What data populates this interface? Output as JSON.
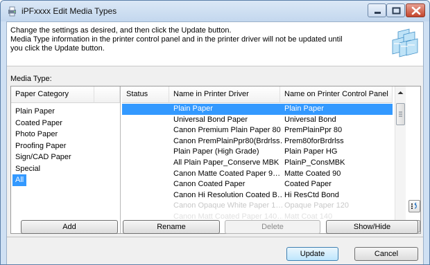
{
  "window": {
    "title": "iPFxxxx Edit Media Types"
  },
  "banner": {
    "lines": [
      "Change the settings as desired, and then click the Update button.",
      "Media Type information in the printer control panel and in the printer driver will not be updated until",
      "you click the Update button."
    ]
  },
  "media_label": "Media Type:",
  "category_header": "Paper Category",
  "categories": [
    "Plain Paper",
    "Coated Paper",
    "Photo Paper",
    "Proofing Paper",
    "Sign/CAD Paper",
    "Special",
    "All"
  ],
  "selected_category": "All",
  "table": {
    "headers": [
      "Status",
      "Name in Printer Driver",
      "Name on Printer Control Panel"
    ],
    "rows": [
      {
        "status": "",
        "driver": "Plain Paper",
        "panel": "Plain Paper"
      },
      {
        "status": "",
        "driver": "Universal Bond Paper",
        "panel": "Universal Bond"
      },
      {
        "status": "",
        "driver": "Canon Premium Plain Paper 80",
        "panel": "PremPlainPpr 80"
      },
      {
        "status": "",
        "driver": "Canon PremPlainPpr80(Brdrlss…",
        "panel": "Prem80forBrdrlss"
      },
      {
        "status": "",
        "driver": "Plain Paper (High Grade)",
        "panel": "Plain Paper HG"
      },
      {
        "status": "",
        "driver": "All Plain Paper_Conserve MBK",
        "panel": "PlainP_ConsMBK"
      },
      {
        "status": "",
        "driver": "Canon Matte Coated Paper 9…",
        "panel": "Matte Coated 90"
      },
      {
        "status": "",
        "driver": "Canon Coated Paper",
        "panel": "Coated Paper"
      },
      {
        "status": "",
        "driver": "Canon Hi Resolution Coated B…",
        "panel": "Hi ResCtd Bond"
      },
      {
        "status": "",
        "driver": "Canon Opaque White Paper 1…",
        "panel": "Opaque Paper 120"
      },
      {
        "status": "",
        "driver": "Canon Matt Coated Paper 140…",
        "panel": "Matt Coat 140"
      }
    ],
    "selected_row": 0
  },
  "buttons": {
    "add": "Add",
    "rename": "Rename",
    "delete": "Delete",
    "show_hide": "Show/Hide",
    "update": "Update",
    "cancel": "Cancel"
  },
  "colors": {
    "selection": "#3399ff",
    "close_button": "#c4452c"
  }
}
